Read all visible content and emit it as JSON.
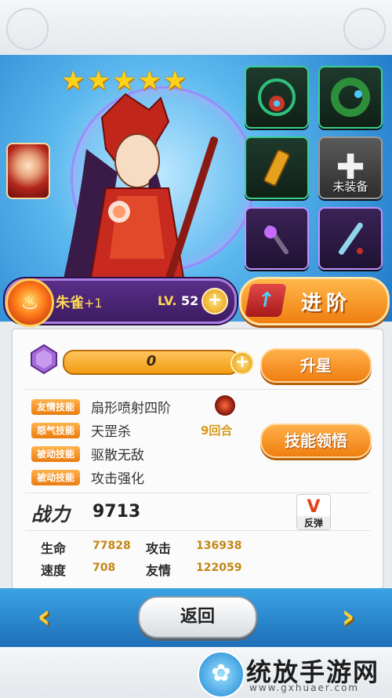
{
  "hero": {
    "star_count": 5,
    "name": "朱雀",
    "name_plus": "+1",
    "level_label": "LV.",
    "level": "52"
  },
  "equipment": {
    "empty_slot_label": "未装备"
  },
  "buttons": {
    "advance": "进阶",
    "star_up": "升星",
    "skill_learn": "技能领悟",
    "back": "返回",
    "nav_prev": "‹",
    "nav_next": "›"
  },
  "exp": {
    "value": "0"
  },
  "skills": [
    {
      "tag": "友情技能",
      "name": "扇形喷射四阶"
    },
    {
      "tag": "怒气技能",
      "name": "天罡杀",
      "extra": "9回合"
    },
    {
      "tag": "被动技能",
      "name": "驱散无敌"
    },
    {
      "tag": "被动技能",
      "name": "攻击强化"
    }
  ],
  "power": {
    "label": "战力",
    "value": "9713"
  },
  "counter_badge": {
    "label": "反弹"
  },
  "stats": {
    "hp_label": "生命",
    "hp": "77828",
    "atk_label": "攻击",
    "atk": "136938",
    "spd_label": "速度",
    "spd": "708",
    "friend_label": "友情",
    "friend": "122059"
  },
  "watermark": {
    "title": "统放手游网",
    "url": "www.gxhuaer.com"
  },
  "colors": {
    "accent_orange": "#f07e10",
    "gold": "#ffd21c",
    "purple_frame": "#a97de2",
    "sky_blue": "#1f78c8"
  }
}
